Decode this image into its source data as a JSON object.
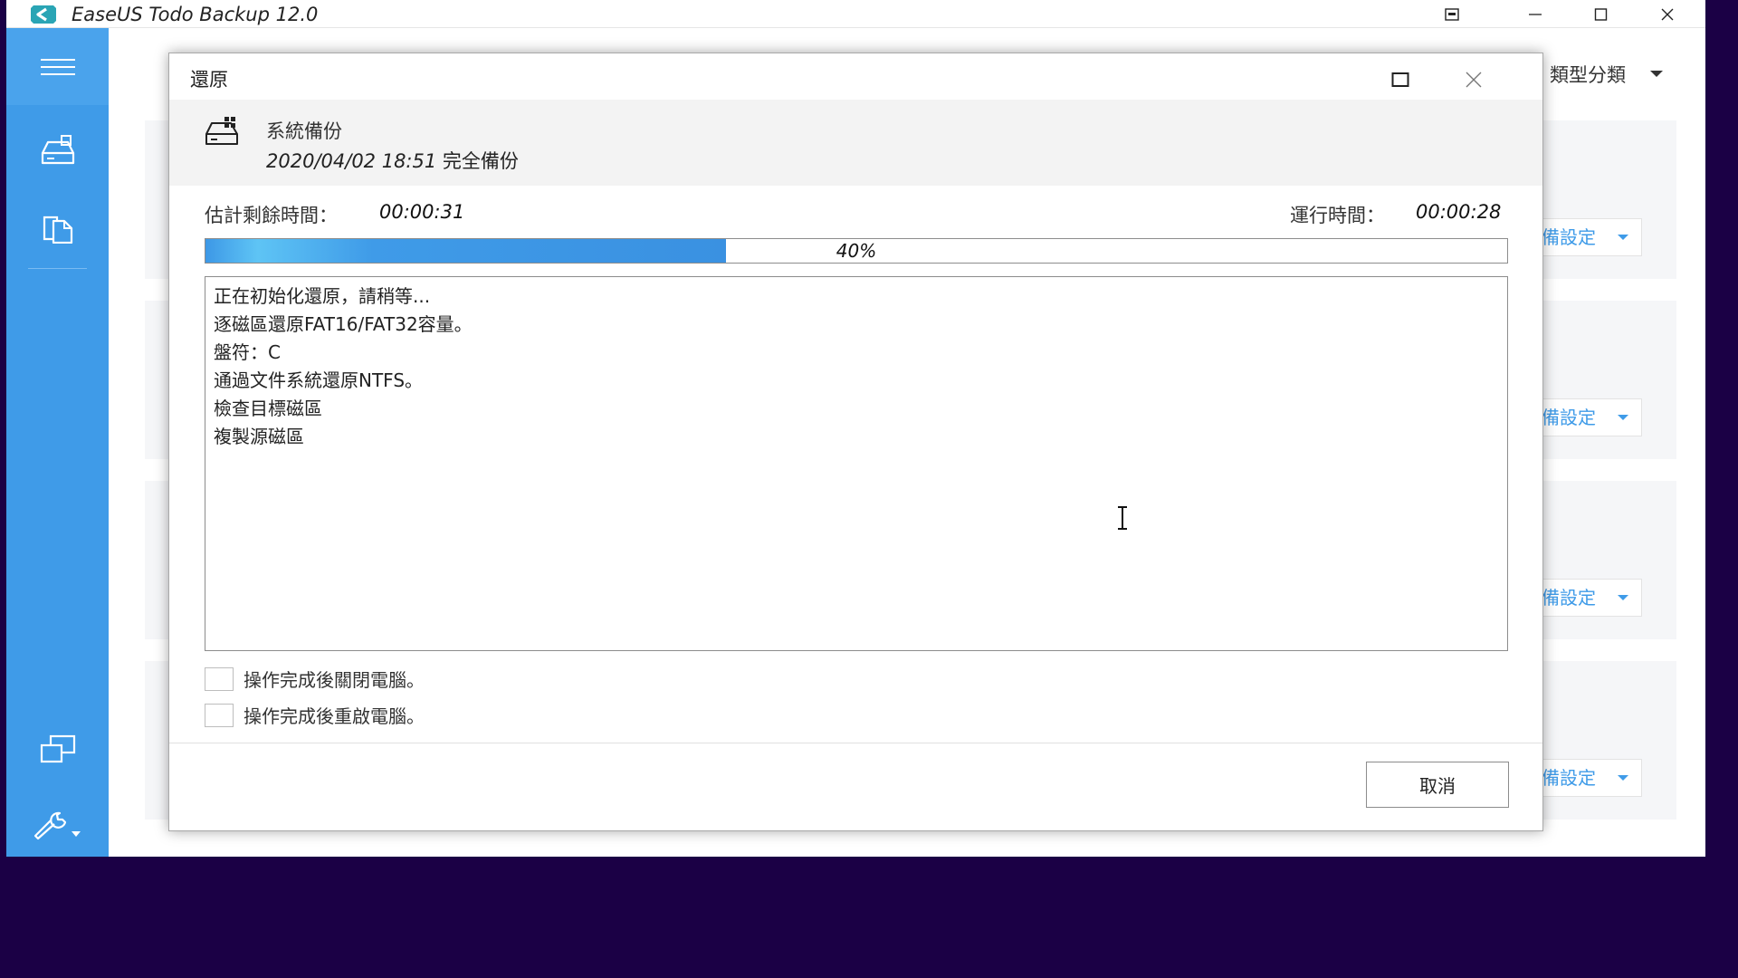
{
  "app": {
    "title": "EaseUS Todo Backup 12.0"
  },
  "titlebar_icons": {
    "restore_window": "window-mode-icon",
    "minimize": "minimize-icon",
    "maximize": "maximize-icon",
    "close": "close-icon"
  },
  "sidebar": {
    "icons": [
      "menu-icon",
      "backup-drive-icon",
      "clone-icon",
      "system-transfer-icon",
      "tools-icon"
    ]
  },
  "main": {
    "sort_label": "類型分類",
    "card_button_label": "備設定"
  },
  "dialog": {
    "title": "還原",
    "backup_name": "系統備份",
    "backup_date": "2020/04/02 18:51",
    "backup_type": "完全備份",
    "eta_label": "估計剩餘時間：",
    "eta_value": "00:00:31",
    "elapsed_label": "運行時間：",
    "elapsed_value": "00:00:28",
    "progress_percent": 40,
    "progress_text": "40%",
    "log_lines": [
      "正在初始化還原，請稍等...",
      "逐磁區還原FAT16/FAT32容量。",
      "盤符：C",
      "通過文件系統還原NTFS。",
      "檢查目標磁區",
      "複製源磁區"
    ],
    "option_shutdown": "操作完成後關閉電腦。",
    "option_restart": "操作完成後重啟電腦。",
    "cancel_label": "取消"
  },
  "colors": {
    "accent": "#3f9be8",
    "desktop": "#1b0045"
  }
}
